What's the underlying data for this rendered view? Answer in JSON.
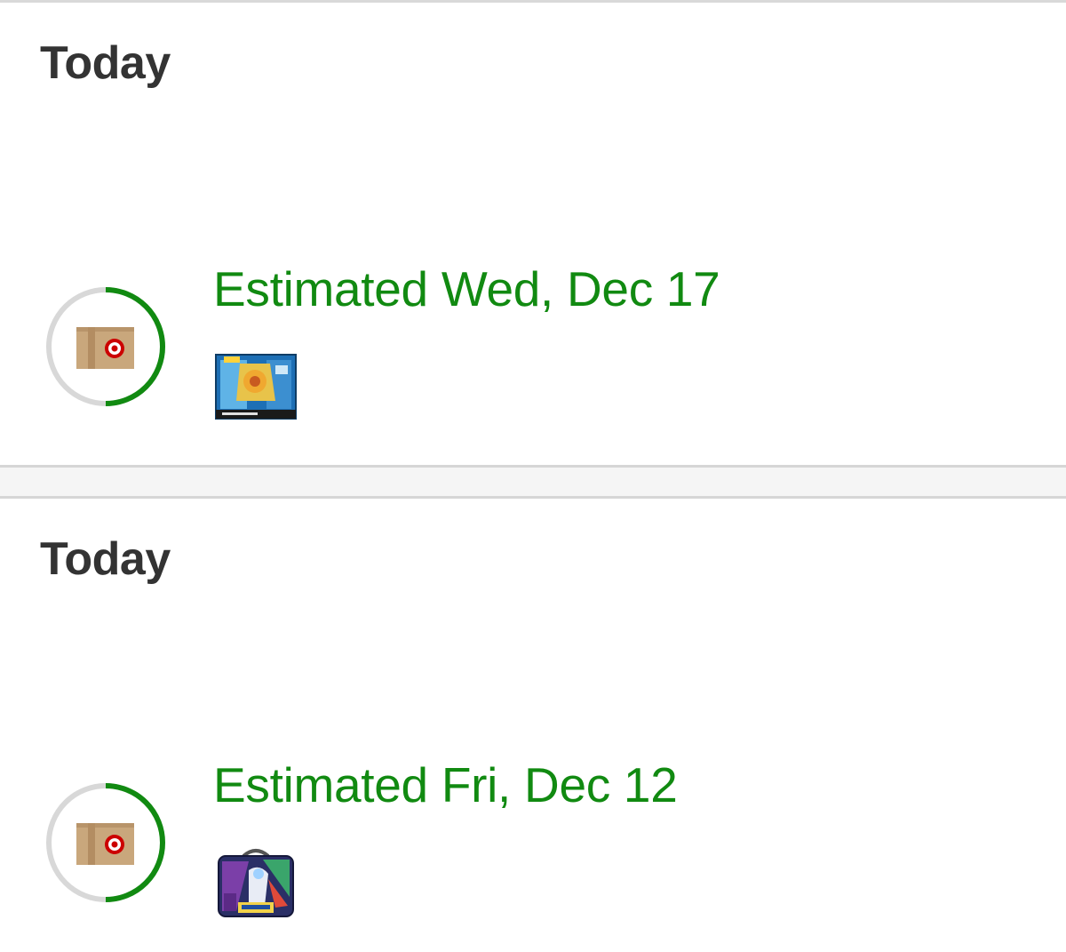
{
  "orders": [
    {
      "date_label": "Today",
      "estimate": "Estimated Wed, Dec 17",
      "progress": 0.5,
      "status_icon": "target-package-icon",
      "thumbnail": "pokemon-card-box-image"
    },
    {
      "date_label": "Today",
      "estimate": "Estimated Fri, Dec 12",
      "progress": 0.5,
      "status_icon": "target-package-icon",
      "thumbnail": "pokemon-collector-tin-image"
    }
  ],
  "colors": {
    "accent_green": "#118a11",
    "heading": "#333333",
    "ring_track": "#d8d8d8",
    "box_tan": "#c9a77c",
    "target_red": "#cc0000"
  }
}
